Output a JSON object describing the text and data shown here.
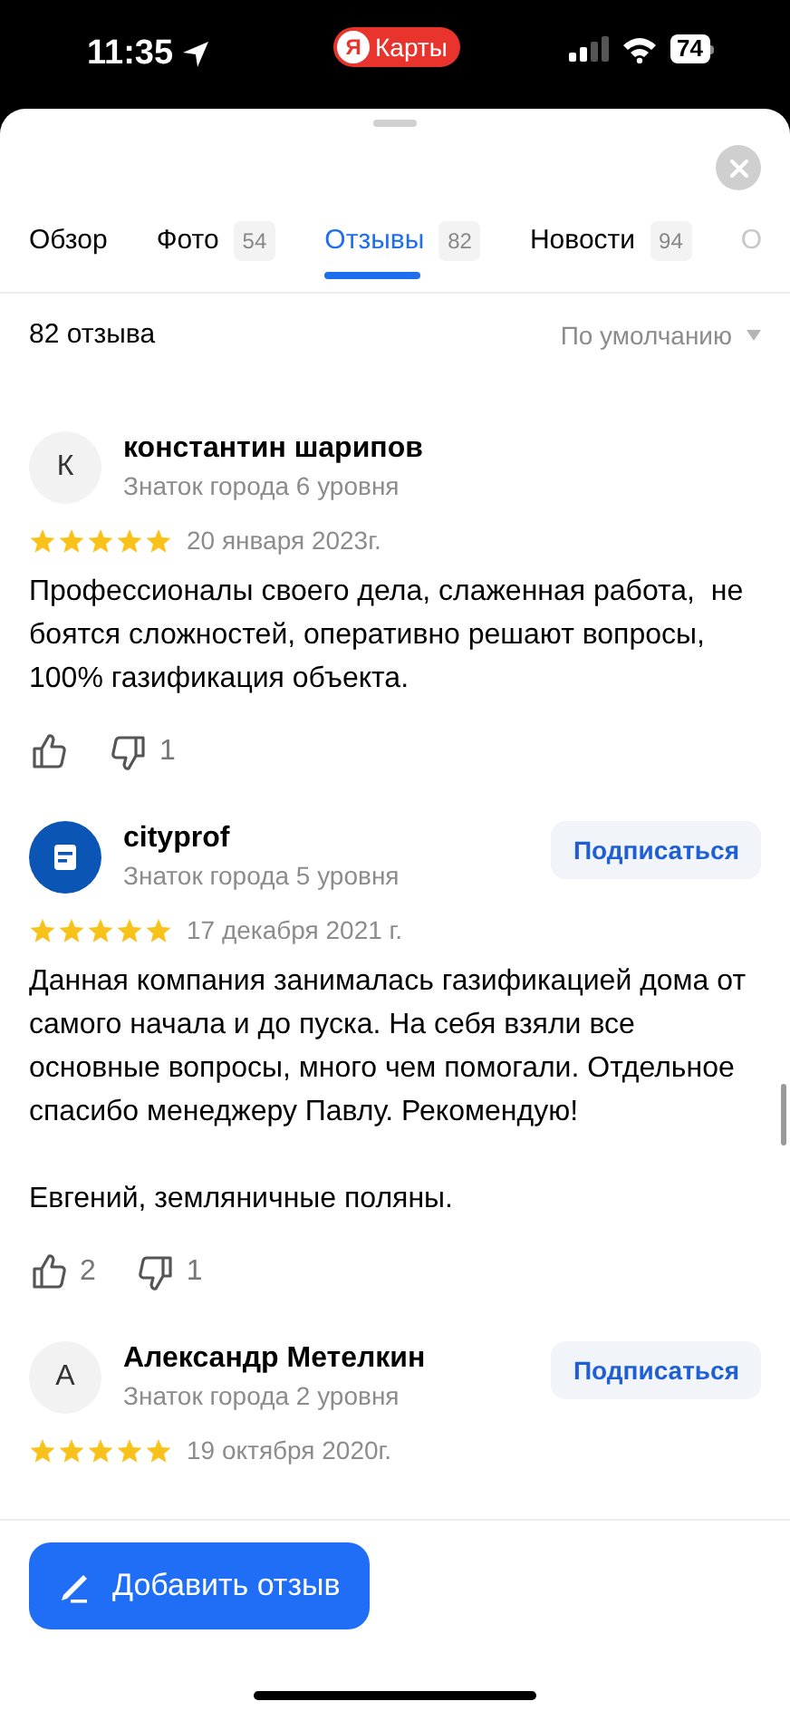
{
  "status_bar": {
    "time": "11:35",
    "app_badge": {
      "logo": "Я",
      "label": "Карты"
    },
    "battery": "74"
  },
  "tabs": [
    {
      "label": "Обзор",
      "selected": false
    },
    {
      "label": "Фото",
      "count": "54",
      "selected": false
    },
    {
      "label": "Отзывы",
      "count": "82",
      "selected": true
    },
    {
      "label": "Новости",
      "count": "94",
      "selected": false
    },
    {
      "label": "О",
      "selected": false
    }
  ],
  "summary": {
    "count": "82 отзыва",
    "sort": "По умолчанию"
  },
  "reviews": [
    {
      "author": {
        "avatar": {
          "kind": "letter",
          "letter": "К"
        },
        "name": "константин шарипов",
        "level": "Знаток города 6 уровня"
      },
      "stars": 5,
      "date": "20 января 2023г.",
      "text": [
        "Профессионалы своего дела, слаженная работа,  не боятся сложностей, оперативно решают вопросы, 100% газификация объекта."
      ],
      "reactions": {
        "dislikes": "1"
      }
    },
    {
      "author": {
        "avatar": {
          "kind": "logo"
        },
        "name": "cityprof",
        "level": "Знаток города 5 уровня"
      },
      "subscribe": "Подписаться",
      "stars": 5,
      "date": "17 декабря 2021 г.",
      "text": [
        "Данная компания занималась газификацией дома от самого начала и до пуска. На себя взяли все основные вопросы, много чем помогали. Отдельное спасибо менеджеру Павлу. Рекомендую!",
        "Евгений, земляничные поляны."
      ],
      "reactions": {
        "likes": "2",
        "dislikes": "1"
      }
    },
    {
      "author": {
        "avatar": {
          "kind": "letter",
          "letter": "А"
        },
        "name": "Александр Метелкин",
        "level": "Знаток города 2 уровня"
      },
      "subscribe": "Подписаться",
      "stars": 5,
      "date": "19 октября 2020г."
    }
  ],
  "add_review_button": "Добавить отзыв"
}
